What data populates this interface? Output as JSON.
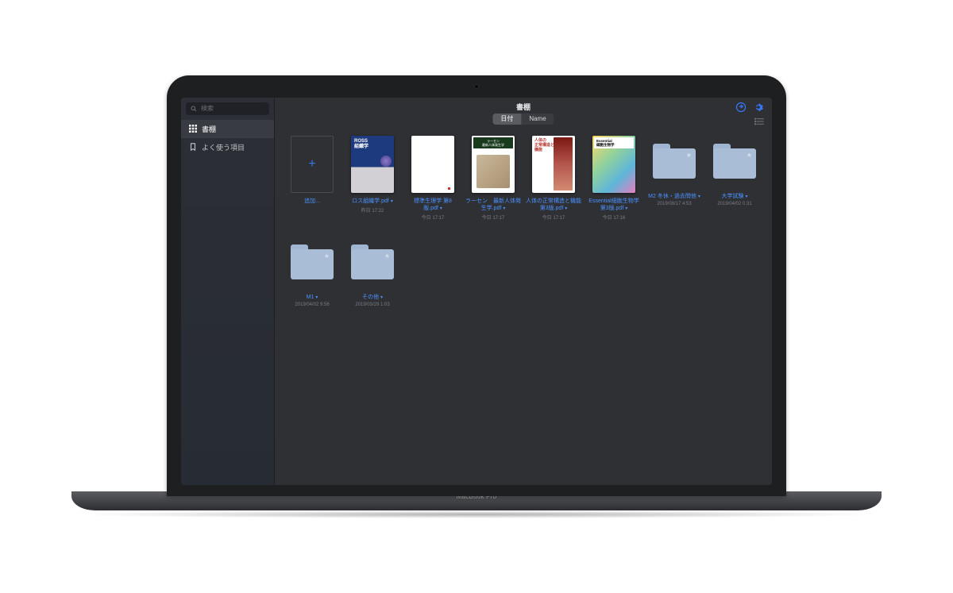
{
  "product_label": "MacBook Pro",
  "search": {
    "placeholder": "検索"
  },
  "sidebar": {
    "items": [
      {
        "label": "書棚",
        "icon": "grid-icon",
        "selected": true
      },
      {
        "label": "よく使う項目",
        "icon": "bookmark-icon",
        "selected": false
      }
    ]
  },
  "header": {
    "title": "書棚",
    "sort_tabs": [
      {
        "label": "日付",
        "selected": true
      },
      {
        "label": "Name",
        "selected": false
      }
    ]
  },
  "add_label": "追加...",
  "items": [
    {
      "type": "book",
      "cover": "cover-1",
      "title": "ロス組織学.pdf",
      "meta": "昨日 17:22"
    },
    {
      "type": "book",
      "cover": "cover-2",
      "title": "標準生理学 第8版.pdf",
      "meta": "今日 17:17"
    },
    {
      "type": "book",
      "cover": "cover-3",
      "title": "ラーセン　最新人体発生学.pdf",
      "meta": "今日 17:17"
    },
    {
      "type": "book",
      "cover": "cover-4",
      "title": "人体の正常構造と機能 第3版.pdf",
      "meta": "今日 17:17"
    },
    {
      "type": "book",
      "cover": "cover-5",
      "title": "Essential細胞生物学 第3版.pdf",
      "meta": "今日 17:16"
    },
    {
      "type": "folder",
      "title": "M2 冬休・過去問他",
      "meta": "2019/08/17 4:53"
    },
    {
      "type": "folder",
      "title": "大学試験",
      "meta": "2019/04/02 0:31"
    },
    {
      "type": "folder",
      "title": "M1",
      "meta": "2019/04/02 9:56"
    },
    {
      "type": "folder",
      "title": "その他",
      "meta": "2019/03/29 1:03"
    }
  ]
}
